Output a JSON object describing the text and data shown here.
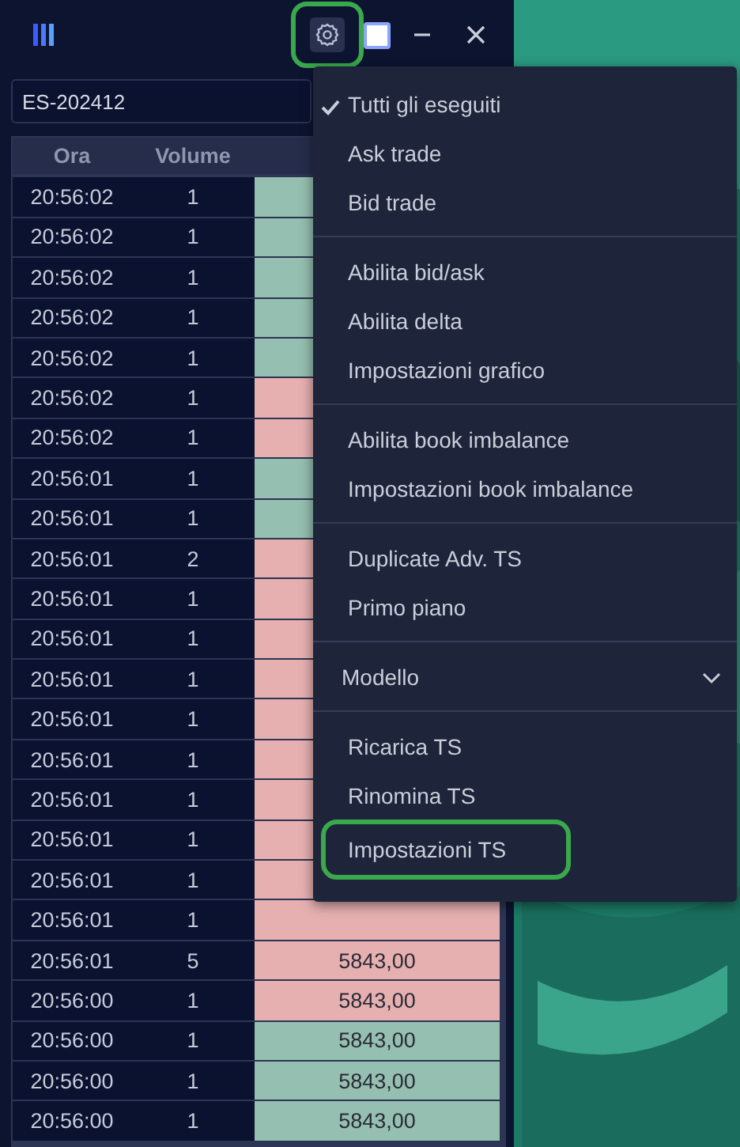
{
  "window": {
    "symbol": "ES-202412",
    "settings_highlighted": true
  },
  "table": {
    "columns": [
      "Ora",
      "Volume"
    ],
    "rows": [
      {
        "time": "20:56:02",
        "volume": "1",
        "color": "#95bfb0"
      },
      {
        "time": "20:56:02",
        "volume": "1",
        "color": "#95bfb0"
      },
      {
        "time": "20:56:02",
        "volume": "1",
        "color": "#95bfb0"
      },
      {
        "time": "20:56:02",
        "volume": "1",
        "color": "#95bfb0"
      },
      {
        "time": "20:56:02",
        "volume": "1",
        "color": "#95bfb0"
      },
      {
        "time": "20:56:02",
        "volume": "1",
        "color": "#e6b0b0"
      },
      {
        "time": "20:56:02",
        "volume": "1",
        "color": "#e6b0b0"
      },
      {
        "time": "20:56:01",
        "volume": "1",
        "color": "#95bfb0"
      },
      {
        "time": "20:56:01",
        "volume": "1",
        "color": "#95bfb0"
      },
      {
        "time": "20:56:01",
        "volume": "2",
        "color": "#e6b0b0"
      },
      {
        "time": "20:56:01",
        "volume": "1",
        "color": "#e6b0b0"
      },
      {
        "time": "20:56:01",
        "volume": "1",
        "color": "#e6b0b0"
      },
      {
        "time": "20:56:01",
        "volume": "1",
        "color": "#e6b0b0"
      },
      {
        "time": "20:56:01",
        "volume": "1",
        "color": "#e6b0b0"
      },
      {
        "time": "20:56:01",
        "volume": "1",
        "color": "#e6b0b0"
      },
      {
        "time": "20:56:01",
        "volume": "1",
        "color": "#e6b0b0"
      },
      {
        "time": "20:56:01",
        "volume": "1",
        "color": "#e6b0b0"
      },
      {
        "time": "20:56:01",
        "volume": "1",
        "color": "#e6b0b0"
      },
      {
        "time": "20:56:01",
        "volume": "1",
        "color": "#e6b0b0"
      },
      {
        "time": "20:56:01",
        "volume": "5",
        "color": "#e6b0b0",
        "price": "5843,00"
      },
      {
        "time": "20:56:00",
        "volume": "1",
        "color": "#e6b0b0",
        "price": "5843,00"
      },
      {
        "time": "20:56:00",
        "volume": "1",
        "color": "#95bfb0",
        "price": "5843,00"
      },
      {
        "time": "20:56:00",
        "volume": "1",
        "color": "#95bfb0",
        "price": "5843,00"
      },
      {
        "time": "20:56:00",
        "volume": "1",
        "color": "#95bfb0",
        "price": "5843,00"
      }
    ]
  },
  "menu": {
    "groups": [
      [
        {
          "label": "Tutti gli eseguiti",
          "kind": "item",
          "checked": true,
          "highlighted": false
        },
        {
          "label": "Ask trade",
          "kind": "item",
          "checked": false,
          "highlighted": false
        },
        {
          "label": "Bid trade",
          "kind": "item",
          "checked": false,
          "highlighted": false
        }
      ],
      [
        {
          "label": "Abilita bid/ask",
          "kind": "item",
          "checked": false,
          "highlighted": false
        },
        {
          "label": "Abilita delta",
          "kind": "item",
          "checked": false,
          "highlighted": false
        },
        {
          "label": "Impostazioni grafico",
          "kind": "item",
          "checked": false,
          "highlighted": false
        }
      ],
      [
        {
          "label": "Abilita book imbalance",
          "kind": "item",
          "checked": false,
          "highlighted": false
        },
        {
          "label": "Impostazioni book imbalance",
          "kind": "item",
          "checked": false,
          "highlighted": false
        }
      ],
      [
        {
          "label": "Duplicate Adv. TS",
          "kind": "item",
          "checked": false,
          "highlighted": false
        },
        {
          "label": "Primo piano",
          "kind": "item",
          "checked": false,
          "highlighted": false
        }
      ],
      [
        {
          "label": "Modello",
          "kind": "submenu",
          "checked": false,
          "highlighted": false
        }
      ],
      [
        {
          "label": "Ricarica TS",
          "kind": "item",
          "checked": false,
          "highlighted": false
        },
        {
          "label": "Rinomina TS",
          "kind": "item",
          "checked": false,
          "highlighted": false
        },
        {
          "label": "Impostazioni TS",
          "kind": "item",
          "checked": false,
          "highlighted": true
        }
      ]
    ]
  }
}
